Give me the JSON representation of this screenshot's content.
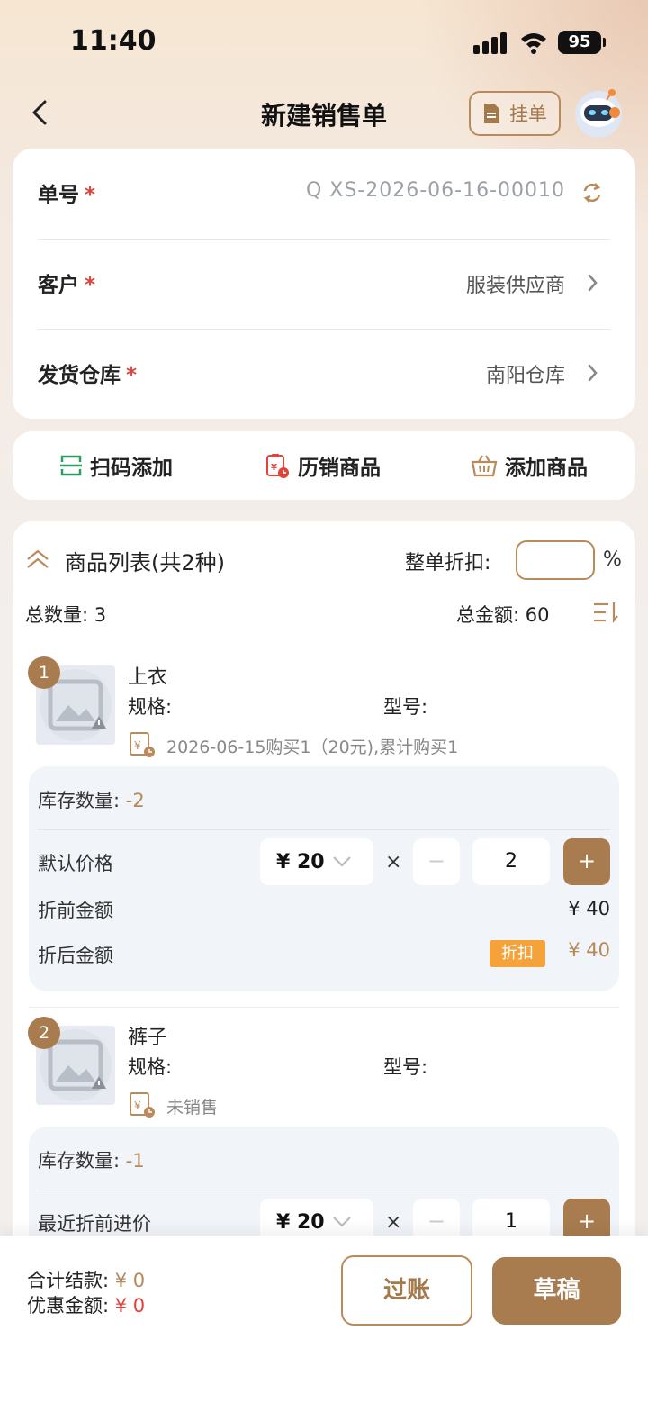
{
  "status": {
    "time": "11:40",
    "battery": "95"
  },
  "nav": {
    "title": "新建销售单",
    "hold_label": "挂单"
  },
  "info": {
    "order_label": "单号",
    "order_value": "Q XS-2026-06-16-00010",
    "customer_label": "客户",
    "customer_value": "服装供应商",
    "warehouse_label": "发货仓库",
    "warehouse_value": "南阳仓库",
    "required_mark": "*"
  },
  "actions": {
    "scan": "扫码添加",
    "history": "历销商品",
    "add": "添加商品"
  },
  "list": {
    "title": "商品列表(共2种)",
    "discount_label": "整单折扣:",
    "percent": "%",
    "total_qty_label": "总数量:",
    "total_qty": "3",
    "total_amt_label": "总金额:",
    "total_amt": "60"
  },
  "items": [
    {
      "index": "1",
      "name": "上衣",
      "spec_label": "规格:",
      "model_label": "型号:",
      "history": "2026-06-15购买1（20元),累计购买1",
      "stock_label": "库存数量:",
      "stock": "-2",
      "price_label": "默认价格",
      "price": "¥ 20",
      "times": "×",
      "minus": "−",
      "qty": "2",
      "plus": "+",
      "pre_label": "折前金额",
      "pre_amount": "¥ 40",
      "post_label": "折后金额",
      "disc_badge": "折扣",
      "post_amount": "¥ 40"
    },
    {
      "index": "2",
      "name": "裤子",
      "spec_label": "规格:",
      "model_label": "型号:",
      "history": "未销售",
      "stock_label": "库存数量:",
      "stock": "-1",
      "price_label": "最近折前进价",
      "price": "¥ 20",
      "times": "×",
      "minus": "−",
      "qty": "1",
      "plus": "+"
    }
  ],
  "bottom": {
    "settle_label": "合计结款:",
    "settle_value": "¥ 0",
    "discount_label": "优惠金额:",
    "discount_value": "¥ 0",
    "post_button": "过账",
    "draft_button": "草稿"
  },
  "colors": {
    "accent": "#a87c4f",
    "required": "#e0433b",
    "badge": "#f5a23a"
  }
}
